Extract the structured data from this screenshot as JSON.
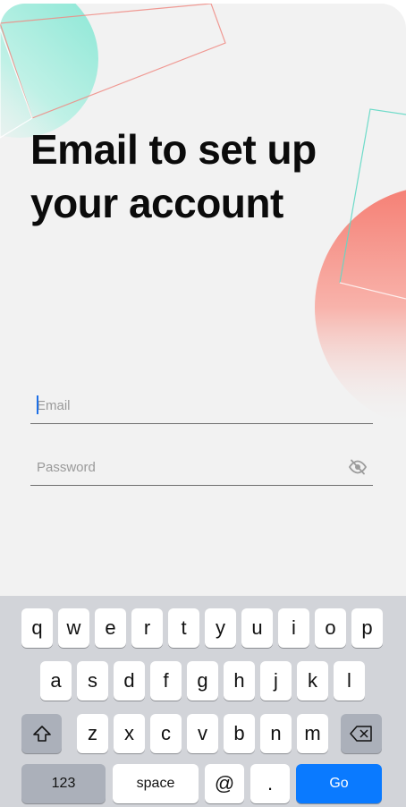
{
  "screen": {
    "title": "Email to set up your account"
  },
  "form": {
    "email_placeholder": "Email",
    "email_value": "",
    "password_placeholder": "Password",
    "password_value": "",
    "password_visibility_icon": "eye-off-icon"
  },
  "keyboard": {
    "row1": [
      "q",
      "w",
      "e",
      "r",
      "t",
      "y",
      "u",
      "i",
      "o",
      "p"
    ],
    "row2": [
      "a",
      "s",
      "d",
      "f",
      "g",
      "h",
      "j",
      "k",
      "l"
    ],
    "row3": [
      "z",
      "x",
      "c",
      "v",
      "b",
      "n",
      "m"
    ],
    "shift_icon": "shift-icon",
    "delete_icon": "backspace-icon",
    "numbers_label": "123",
    "space_label": "space",
    "at_label": "@",
    "period_label": ".",
    "go_label": "Go"
  },
  "colors": {
    "accent": "#0a7aff",
    "teal": "#7fe3cf",
    "coral": "#f47d73",
    "background": "#f2f2f2",
    "keyboard_bg": "#d2d4d9"
  }
}
